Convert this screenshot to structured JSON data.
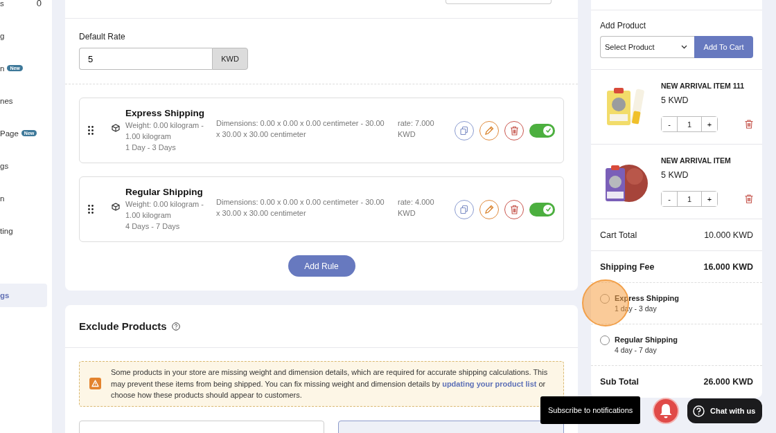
{
  "sidebar": {
    "items": [
      {
        "label": "s",
        "count": "0",
        "selected": false
      },
      {
        "label": "g",
        "selected": false
      },
      {
        "label": "n",
        "badge": "New",
        "selected": false
      },
      {
        "label": "nes",
        "selected": false
      },
      {
        "label": "Page",
        "badge": "New",
        "selected": false
      },
      {
        "label": "gs",
        "selected": false
      },
      {
        "label": "n",
        "selected": false
      },
      {
        "label": "ting",
        "selected": false
      },
      {
        "label": "gs",
        "selected": true
      }
    ]
  },
  "default_rate": {
    "label": "Default Rate",
    "value": "5",
    "unit": "KWD"
  },
  "rules": [
    {
      "name": "Express Shipping",
      "weight": "Weight: 0.00 kilogram - 1.00 kilogram",
      "duration": "1 Day - 3 Days",
      "dimensions": "Dimensions: 0.00 x 0.00 x 0.00 centimeter - 30.00 x 30.00 x 30.00 centimeter",
      "rate": "rate: 7.000 KWD",
      "on": true
    },
    {
      "name": "Regular Shipping",
      "weight": "Weight: 0.00 kilogram - 1.00 kilogram",
      "duration": "4 Days - 7 Days",
      "dimensions": "Dimensions: 0.00 x 0.00 x 0.00 centimeter - 30.00 x 30.00 x 30.00 centimeter",
      "rate": "rate: 4.000 KWD",
      "on": true
    }
  ],
  "add_rule_button": "Add Rule",
  "exclude_products": {
    "title": "Exclude Products",
    "warning": "Some products in your store are missing weight and dimension details, which are required for accurate shipping calculations. This may prevent these items from being shipped. You can fix missing weight and dimension details by ",
    "link": "updating your product list",
    "warning_end": " or choose how these products should appear to customers."
  },
  "cart": {
    "add_product_label": "Add Product",
    "select_placeholder": "Select Product",
    "add_button": "Add To Cart",
    "items": [
      {
        "name": "NEW ARRIVAL ITEM 111",
        "price": "5 KWD",
        "decrease": "-",
        "quantity": "1",
        "increase": "+"
      },
      {
        "name": "NEW ARRIVAL ITEM",
        "price": "5 KWD",
        "decrease": "-",
        "quantity": "1",
        "increase": "+"
      }
    ],
    "cart_total_label": "Cart Total",
    "cart_total": "10.000 KWD",
    "shipping_fee_label": "Shipping Fee",
    "shipping_fee": "16.000 KWD",
    "shipping_options": [
      {
        "name": "Express Shipping",
        "duration": "1 day - 3 day",
        "selected": false
      },
      {
        "name": "Regular Shipping",
        "duration": "4 day - 7 day",
        "selected": false
      }
    ],
    "sub_total_label": "Sub Total",
    "sub_total": "26.000 KWD"
  },
  "notification_tooltip": "Subscribe to notifications",
  "chat_button": "Chat with us"
}
